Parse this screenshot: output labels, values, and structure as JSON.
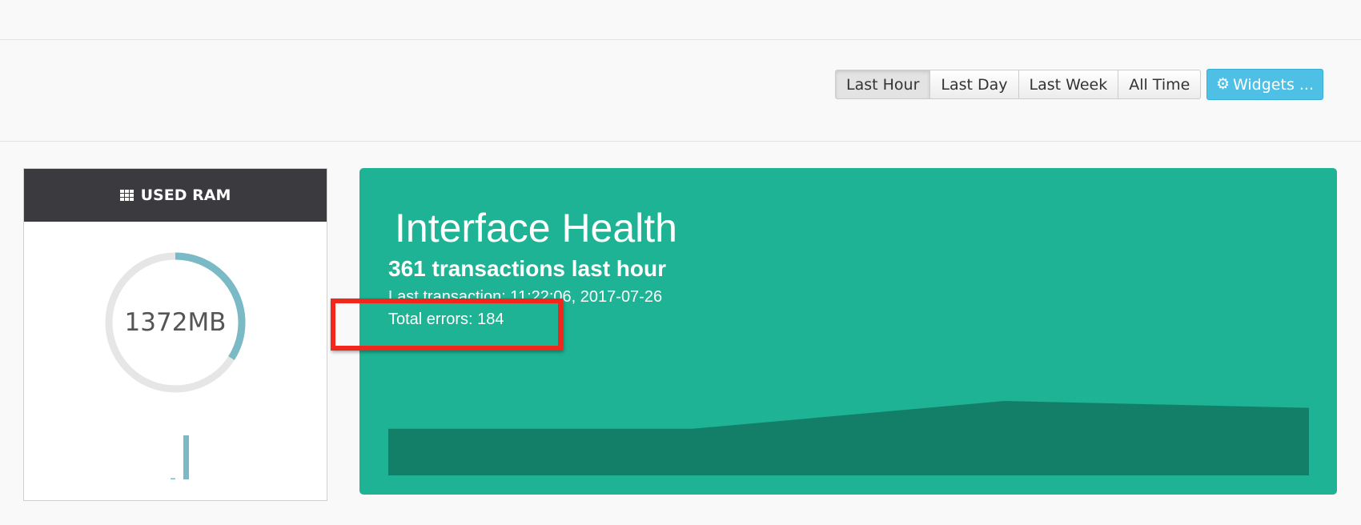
{
  "toolbar": {
    "ranges": [
      {
        "label": "Last Hour",
        "active": true
      },
      {
        "label": "Last Day",
        "active": false
      },
      {
        "label": "Last Week",
        "active": false
      },
      {
        "label": "All Time",
        "active": false
      }
    ],
    "widgets_label": "Widgets ...",
    "widgets_icon": "gear-icon",
    "accent_color": "#4fc0e5"
  },
  "ram": {
    "title": "USED RAM",
    "title_icon": "grid-icon",
    "value": "1372MB",
    "gauge_fraction": 0.34,
    "gauge_color": "#7ab9c6",
    "history": [
      0.02,
      1.0
    ]
  },
  "health": {
    "title": "Interface Health",
    "subtitle": "361 transactions last hour",
    "last_transaction": "Last transaction: 11:22:06, 2017-07-26",
    "total_errors": "Total errors: 184",
    "background_color": "#1db394",
    "area_color": "#137f68",
    "sparkline": [
      0.47,
      0.47,
      0.47,
      0.47,
      0.75,
      0.68
    ]
  },
  "annotation": {
    "color": "#f0271a"
  }
}
